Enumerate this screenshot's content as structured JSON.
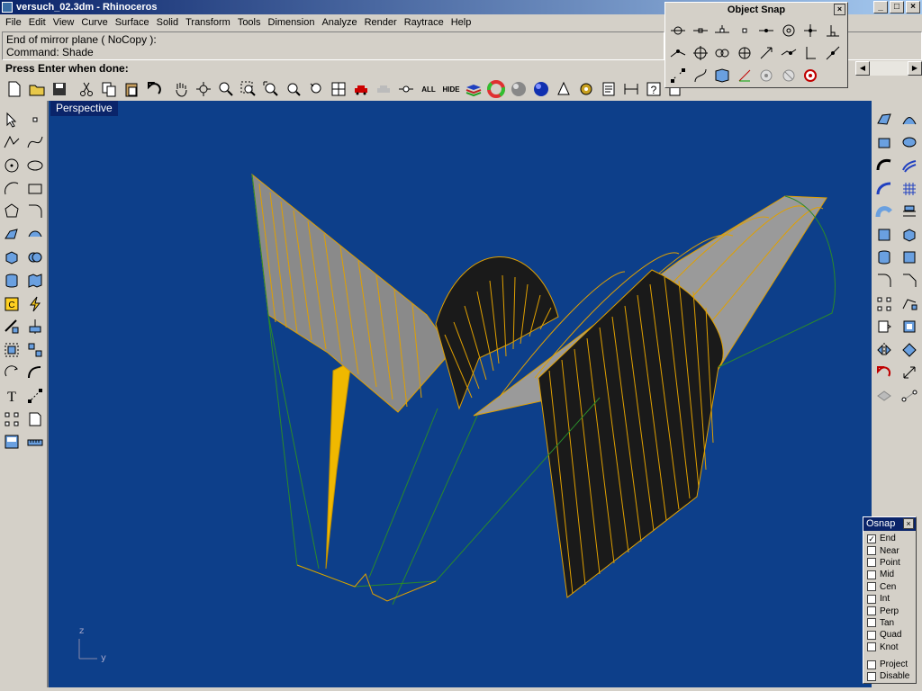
{
  "window": {
    "title": "versuch_02.3dm - Rhinoceros"
  },
  "window_controls": [
    "_",
    "□",
    "×"
  ],
  "menu": [
    "File",
    "Edit",
    "View",
    "Curve",
    "Surface",
    "Solid",
    "Transform",
    "Tools",
    "Dimension",
    "Analyze",
    "Render",
    "Raytrace",
    "Help"
  ],
  "command": {
    "history": [
      "End of mirror plane ( NoCopy ):",
      "Command: Shade"
    ],
    "prompt": "Press Enter when done:"
  },
  "toolbar": {
    "all_label": "ALL",
    "hide_label": "HIDE"
  },
  "viewport": {
    "label": "Perspective",
    "background": "#0d3f8a",
    "axis_z": "z",
    "axis_y": "y"
  },
  "object_snap_toolbar": {
    "title": "Object Snap",
    "close": "×"
  },
  "osnap_panel": {
    "title": "Osnap",
    "close": "×",
    "items": [
      {
        "label": "End",
        "checked": true
      },
      {
        "label": "Near",
        "checked": false
      },
      {
        "label": "Point",
        "checked": false
      },
      {
        "label": "Mid",
        "checked": false
      },
      {
        "label": "Cen",
        "checked": false
      },
      {
        "label": "Int",
        "checked": false
      },
      {
        "label": "Perp",
        "checked": false
      },
      {
        "label": "Tan",
        "checked": false
      },
      {
        "label": "Quad",
        "checked": false
      },
      {
        "label": "Knot",
        "checked": false
      }
    ],
    "extras": [
      {
        "label": "Project",
        "checked": false
      },
      {
        "label": "Disable",
        "checked": false
      }
    ]
  },
  "colors": {
    "titlebar": "#0a246a",
    "surface_yellow": "#f0b800",
    "surface_grey": "#8a8a8a",
    "surface_dark": "#1a1a1a",
    "edge_green": "#2a8a2a"
  }
}
